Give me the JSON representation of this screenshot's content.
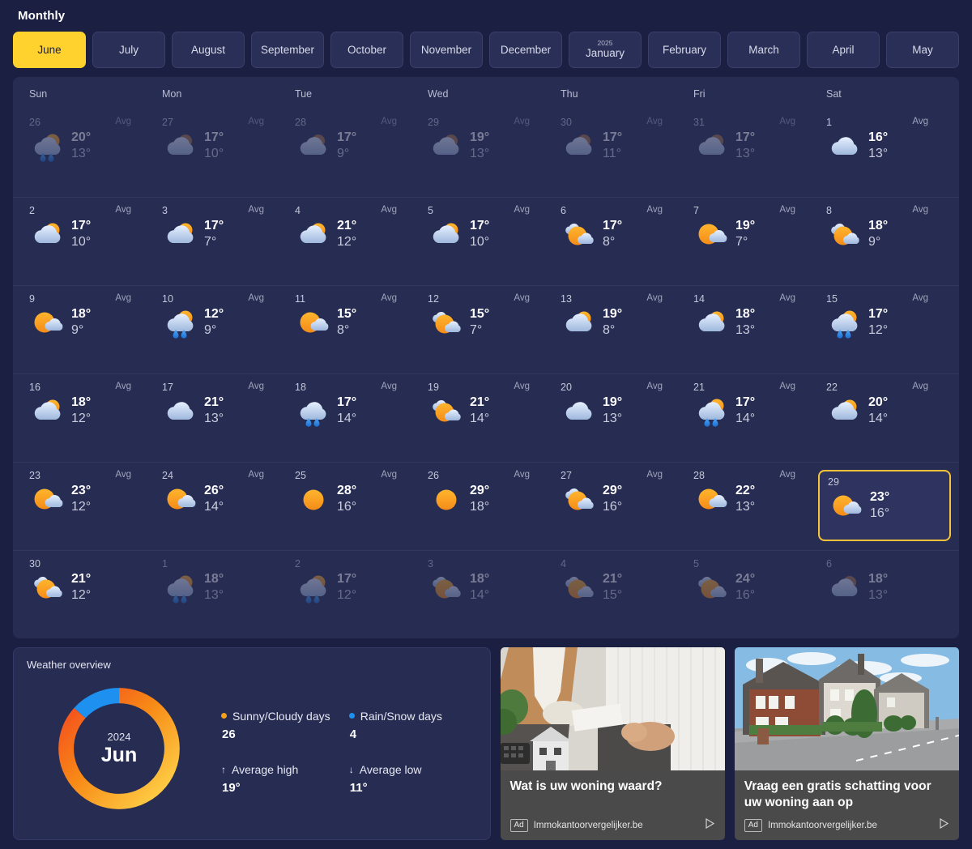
{
  "header": {
    "title": "Monthly"
  },
  "month_tabs": [
    {
      "label": "June",
      "year": "",
      "active": true
    },
    {
      "label": "July",
      "year": "",
      "active": false
    },
    {
      "label": "August",
      "year": "",
      "active": false
    },
    {
      "label": "September",
      "year": "",
      "active": false
    },
    {
      "label": "October",
      "year": "",
      "active": false
    },
    {
      "label": "November",
      "year": "",
      "active": false
    },
    {
      "label": "December",
      "year": "",
      "active": false
    },
    {
      "label": "January",
      "year": "2025",
      "active": false
    },
    {
      "label": "February",
      "year": "",
      "active": false
    },
    {
      "label": "March",
      "year": "",
      "active": false
    },
    {
      "label": "April",
      "year": "",
      "active": false
    },
    {
      "label": "May",
      "year": "",
      "active": false
    }
  ],
  "weekdays": [
    "Sun",
    "Mon",
    "Tue",
    "Wed",
    "Thu",
    "Fri",
    "Sat"
  ],
  "avg_label": "Avg",
  "weeks": [
    [
      {
        "day": "26",
        "high": "20°",
        "low": "13°",
        "icon": "rain-sun",
        "outside": true,
        "avg": true
      },
      {
        "day": "27",
        "high": "17°",
        "low": "10°",
        "icon": "cloudy-sun",
        "outside": true,
        "avg": true
      },
      {
        "day": "28",
        "high": "17°",
        "low": "9°",
        "icon": "cloudy-sun",
        "outside": true,
        "avg": true
      },
      {
        "day": "29",
        "high": "19°",
        "low": "13°",
        "icon": "cloudy-sun",
        "outside": true,
        "avg": true
      },
      {
        "day": "30",
        "high": "17°",
        "low": "11°",
        "icon": "cloudy-sun",
        "outside": true,
        "avg": true
      },
      {
        "day": "31",
        "high": "17°",
        "low": "13°",
        "icon": "cloudy-sun",
        "outside": true,
        "avg": true
      },
      {
        "day": "1",
        "high": "16°",
        "low": "13°",
        "icon": "cloudy",
        "outside": false,
        "avg": true
      }
    ],
    [
      {
        "day": "2",
        "high": "17°",
        "low": "10°",
        "icon": "partly-cloudy",
        "outside": false,
        "avg": true
      },
      {
        "day": "3",
        "high": "17°",
        "low": "7°",
        "icon": "partly-cloudy",
        "outside": false,
        "avg": true
      },
      {
        "day": "4",
        "high": "21°",
        "low": "12°",
        "icon": "partly-cloudy",
        "outside": false,
        "avg": true
      },
      {
        "day": "5",
        "high": "17°",
        "low": "10°",
        "icon": "partly-cloudy",
        "outside": false,
        "avg": true
      },
      {
        "day": "6",
        "high": "17°",
        "low": "8°",
        "icon": "mostly-sunny",
        "outside": false,
        "avg": true
      },
      {
        "day": "7",
        "high": "19°",
        "low": "7°",
        "icon": "sunny-small-cloud",
        "outside": false,
        "avg": true
      },
      {
        "day": "8",
        "high": "18°",
        "low": "9°",
        "icon": "mostly-sunny",
        "outside": false,
        "avg": true
      }
    ],
    [
      {
        "day": "9",
        "high": "18°",
        "low": "9°",
        "icon": "sunny-small-cloud",
        "outside": false,
        "avg": true
      },
      {
        "day": "10",
        "high": "12°",
        "low": "9°",
        "icon": "rain-sun",
        "outside": false,
        "avg": true
      },
      {
        "day": "11",
        "high": "15°",
        "low": "8°",
        "icon": "sunny-small-cloud",
        "outside": false,
        "avg": true
      },
      {
        "day": "12",
        "high": "15°",
        "low": "7°",
        "icon": "mostly-sunny",
        "outside": false,
        "avg": true
      },
      {
        "day": "13",
        "high": "19°",
        "low": "8°",
        "icon": "partly-cloudy",
        "outside": false,
        "avg": true
      },
      {
        "day": "14",
        "high": "18°",
        "low": "13°",
        "icon": "partly-cloudy",
        "outside": false,
        "avg": true
      },
      {
        "day": "15",
        "high": "17°",
        "low": "12°",
        "icon": "rain-sun",
        "outside": false,
        "avg": true
      }
    ],
    [
      {
        "day": "16",
        "high": "18°",
        "low": "12°",
        "icon": "partly-cloudy",
        "outside": false,
        "avg": true
      },
      {
        "day": "17",
        "high": "21°",
        "low": "13°",
        "icon": "cloudy",
        "outside": false,
        "avg": true
      },
      {
        "day": "18",
        "high": "17°",
        "low": "14°",
        "icon": "rain",
        "outside": false,
        "avg": true
      },
      {
        "day": "19",
        "high": "21°",
        "low": "14°",
        "icon": "mostly-sunny",
        "outside": false,
        "avg": true
      },
      {
        "day": "20",
        "high": "19°",
        "low": "13°",
        "icon": "cloudy",
        "outside": false,
        "avg": true
      },
      {
        "day": "21",
        "high": "17°",
        "low": "14°",
        "icon": "rain-sun",
        "outside": false,
        "avg": true
      },
      {
        "day": "22",
        "high": "20°",
        "low": "14°",
        "icon": "partly-cloudy",
        "outside": false,
        "avg": true
      }
    ],
    [
      {
        "day": "23",
        "high": "23°",
        "low": "12°",
        "icon": "sunny-small-cloud",
        "outside": false,
        "avg": true
      },
      {
        "day": "24",
        "high": "26°",
        "low": "14°",
        "icon": "sunny-small-cloud",
        "outside": false,
        "avg": true
      },
      {
        "day": "25",
        "high": "28°",
        "low": "16°",
        "icon": "sunny",
        "outside": false,
        "avg": true
      },
      {
        "day": "26",
        "high": "29°",
        "low": "18°",
        "icon": "sunny",
        "outside": false,
        "avg": true
      },
      {
        "day": "27",
        "high": "29°",
        "low": "16°",
        "icon": "mostly-sunny",
        "outside": false,
        "avg": true
      },
      {
        "day": "28",
        "high": "22°",
        "low": "13°",
        "icon": "sunny-small-cloud",
        "outside": false,
        "avg": true
      },
      {
        "day": "29",
        "high": "23°",
        "low": "16°",
        "icon": "sunny-small-cloud",
        "outside": false,
        "avg": false,
        "selected": true
      }
    ],
    [
      {
        "day": "30",
        "high": "21°",
        "low": "12°",
        "icon": "mostly-sunny",
        "outside": false,
        "avg": false
      },
      {
        "day": "1",
        "high": "18°",
        "low": "13°",
        "icon": "rain-sun",
        "outside": true,
        "avg": false
      },
      {
        "day": "2",
        "high": "17°",
        "low": "12°",
        "icon": "rain-sun",
        "outside": true,
        "avg": false
      },
      {
        "day": "3",
        "high": "18°",
        "low": "14°",
        "icon": "mostly-sunny",
        "outside": true,
        "avg": false
      },
      {
        "day": "4",
        "high": "21°",
        "low": "15°",
        "icon": "mostly-sunny",
        "outside": true,
        "avg": false
      },
      {
        "day": "5",
        "high": "24°",
        "low": "16°",
        "icon": "mostly-sunny",
        "outside": true,
        "avg": false
      },
      {
        "day": "6",
        "high": "18°",
        "low": "13°",
        "icon": "cloudy-sun",
        "outside": true,
        "avg": false
      }
    ]
  ],
  "overview": {
    "title": "Weather overview",
    "center_year": "2024",
    "center_month": "Jun",
    "legend": [
      {
        "label": "Sunny/Cloudy days",
        "value": "26",
        "color": "#f7a11a",
        "glyph": "dot"
      },
      {
        "label": "Rain/Snow days",
        "value": "4",
        "color": "#1e90f0",
        "glyph": "dot"
      },
      {
        "label": "Average high",
        "value": "19°",
        "color": "#e6e8f2",
        "glyph": "↑"
      },
      {
        "label": "Average low",
        "value": "11°",
        "color": "#e6e8f2",
        "glyph": "↓"
      }
    ]
  },
  "chart_data": {
    "type": "pie",
    "title": "Weather overview",
    "categories": [
      "Sunny/Cloudy days",
      "Rain/Snow days"
    ],
    "values": [
      26,
      4
    ],
    "colors": [
      "#f7a11a",
      "#1e90f0"
    ],
    "center_label": "2024 Jun",
    "legend_position": "right",
    "annotations": [
      "Average high 19°",
      "Average low 11°"
    ]
  },
  "ads": [
    {
      "title": "Wat is uw woning waard?",
      "badge": "Ad",
      "domain": "Immokantoorvergelijker.be",
      "image": "woman-with-house-model"
    },
    {
      "title": "Vraag een gratis schatting voor uw woning aan op",
      "badge": "Ad",
      "domain": "Immokantoorvergelijker.be",
      "image": "suburban-street-houses"
    }
  ]
}
